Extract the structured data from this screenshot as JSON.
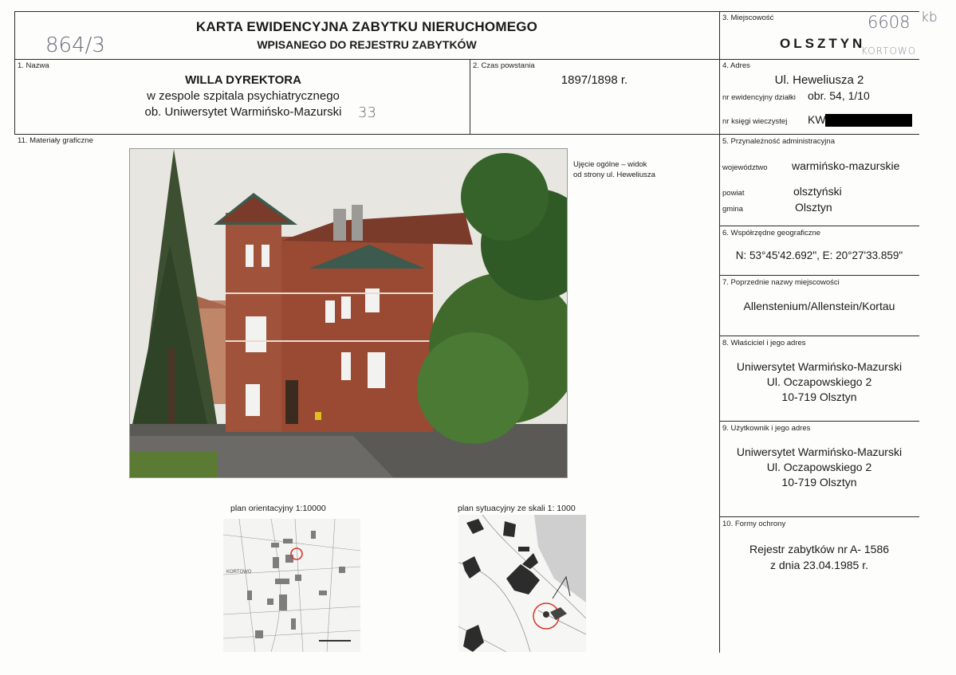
{
  "header": {
    "title_line1": "KARTA EWIDENCYJNA ZABYTKU NIERUCHOMEGO",
    "title_line2": "WPISANEGO DO REJESTRU ZABYTKÓW",
    "handwritten_number": "864/3"
  },
  "locality": {
    "label": "3. Miejscowość",
    "value": "OLSZTYN",
    "hand_code": "6608",
    "hand_initials": "kb",
    "hand_note": "KORTOWO"
  },
  "name": {
    "label": "1. Nazwa",
    "line1": "WILLA DYREKTORA",
    "line2": "w zespole szpitala psychiatrycznego",
    "line3": "ob. Uniwersytet Warmińsko-Mazurski",
    "hand_mark": "33"
  },
  "time": {
    "label": "2. Czas powstania",
    "value": "1897/1898 r."
  },
  "address": {
    "label": "4. Adres",
    "street": "Ul. Heweliusza 2",
    "plot_label": "nr ewidencyjny działki",
    "plot_value": "obr. 54, 1/10",
    "kw_label": "nr księgi wieczystej",
    "kw_value": "KW"
  },
  "graphics": {
    "label": "11. Materiały graficzne",
    "photo_caption_line1": "Ujęcie ogólne – widok",
    "photo_caption_line2": "od strony ul. Heweliusza",
    "plan1_caption": "plan orientacyjny 1:10000",
    "plan2_caption": "plan sytuacyjny ze skali 1: 1000",
    "plan1_map_label": "KORTOWO"
  },
  "admin": {
    "label": "5. Przynależność administracyjna",
    "woj_label": "województwo",
    "woj_value": "warmińsko-mazurskie",
    "powiat_label": "powiat",
    "powiat_value": "olsztyński",
    "gmina_label": "gmina",
    "gmina_value": "Olsztyn"
  },
  "coords": {
    "label": "6. Współrzędne geograficzne",
    "value": "N: 53°45'42.692\", E: 20°27'33.859\""
  },
  "prev_names": {
    "label": "7. Poprzednie nazwy miejscowości",
    "value": "Allenstenium/Allenstein/Kortau"
  },
  "owner": {
    "label": "8. Właściciel i jego adres",
    "line1": "Uniwersytet Warmińsko-Mazurski",
    "line2": "Ul. Oczapowskiego 2",
    "line3": "10-719 Olsztyn"
  },
  "user": {
    "label": "9. Użytkownik i jego adres",
    "line1": "Uniwersytet Warmińsko-Mazurski",
    "line2": "Ul. Oczapowskiego 2",
    "line3": "10-719 Olsztyn"
  },
  "protection": {
    "label": "10. Formy ochrony",
    "line1": "Rejestr zabytków nr A- 1586",
    "line2": "z dnia 23.04.1985 r."
  },
  "colors": {
    "brick": "#9a4a33",
    "roof": "#7a3b2a",
    "foliage": "#3f6a2c",
    "sky": "#eceae6",
    "redaction": "#000000",
    "circle_red": "#d8362b"
  }
}
